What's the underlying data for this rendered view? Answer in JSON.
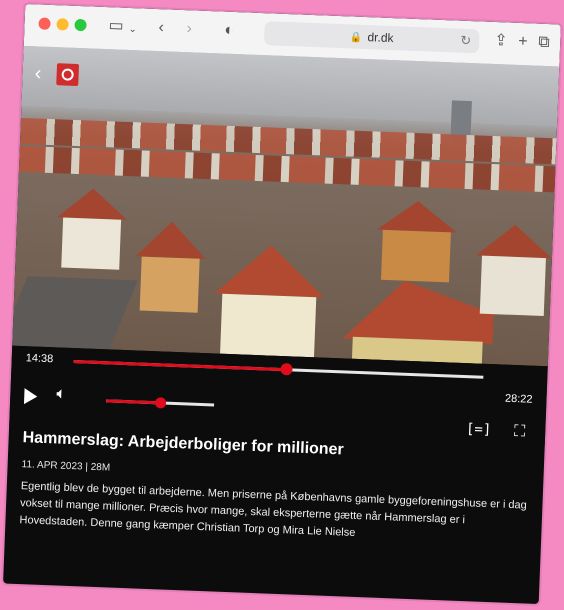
{
  "browser": {
    "url": "dr.dk"
  },
  "player": {
    "current_time": "14:38",
    "total_time": "28:22",
    "progress": 0.52,
    "volume": 0.5
  },
  "program": {
    "title": "Hammerslag: Arbejderboliger for millioner",
    "meta": "11. APR 2023 | 28M",
    "description": "Egentlig blev de bygget til arbejderne. Men priserne på Københavns gamle byggeforeningshuse er i dag vokset til mange millioner. Præcis hvor mange, skal eksperterne gætte når Hammerslag er i Hovedstaden. Denne gang kæmper Christian Torp og Mira Lie Nielse"
  },
  "icons": {
    "subtitles": "[=]",
    "fullscreen": "⛶"
  },
  "colors": {
    "accent": "#e00c1b",
    "background": "#f58ac3"
  }
}
